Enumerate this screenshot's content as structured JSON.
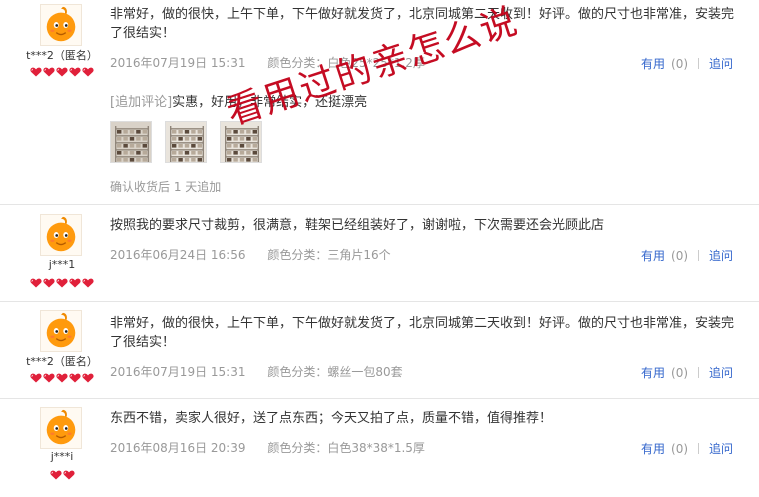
{
  "reviews": [
    {
      "user": "t***2（匿名）",
      "hearts": 5,
      "content": "非常好，做的很快，上午下单，下午做好就发货了，北京同城第二天收到！好评。做的尺寸也非常准，安装完了很结实！",
      "date": "2016年07月19日 15:31",
      "sku": "颜色分类：白色25*25*1.2厚",
      "useful_label": "有用",
      "useful_count": "(0)",
      "reply_label": "追问",
      "append_tag": "[追加评论]",
      "append_text": "实惠，好用，非常结实，还挺漂亮",
      "confirm_text": "确认收货后 1 天追加"
    },
    {
      "user": "j***1",
      "hearts": 5,
      "content": "按照我的要求尺寸裁剪，很满意，鞋架已经组装好了，谢谢啦，下次需要还会光顾此店",
      "date": "2016年06月24日 16:56",
      "sku": "颜色分类：三角片16个",
      "useful_label": "有用",
      "useful_count": "(0)",
      "reply_label": "追问"
    },
    {
      "user": "t***2（匿名）",
      "hearts": 5,
      "content": "非常好，做的很快，上午下单，下午做好就发货了，北京同城第二天收到！好评。做的尺寸也非常准，安装完了很结实！",
      "date": "2016年07月19日 15:31",
      "sku": "颜色分类：螺丝一包80套",
      "useful_label": "有用",
      "useful_count": "(0)",
      "reply_label": "追问"
    },
    {
      "user": "j***i",
      "hearts": 2,
      "content": "东西不错，卖家人很好，送了点东西；今天又拍了点，质量不错，值得推荐！",
      "date": "2016年08月16日 20:39",
      "sku": "颜色分类：白色38*38*1.5厚",
      "useful_label": "有用",
      "useful_count": "(0)",
      "reply_label": "追问"
    }
  ],
  "watermark": "看用过的亲怎么说",
  "colors": {
    "link": "#3366cc",
    "meta": "#999999",
    "heart": "#e0203a",
    "watermark": "#c20018"
  },
  "icons": {
    "avatar": "orange-mascot-avatar-icon",
    "heart": "heart-icon",
    "photo": "shelf-photo-thumbnail"
  }
}
